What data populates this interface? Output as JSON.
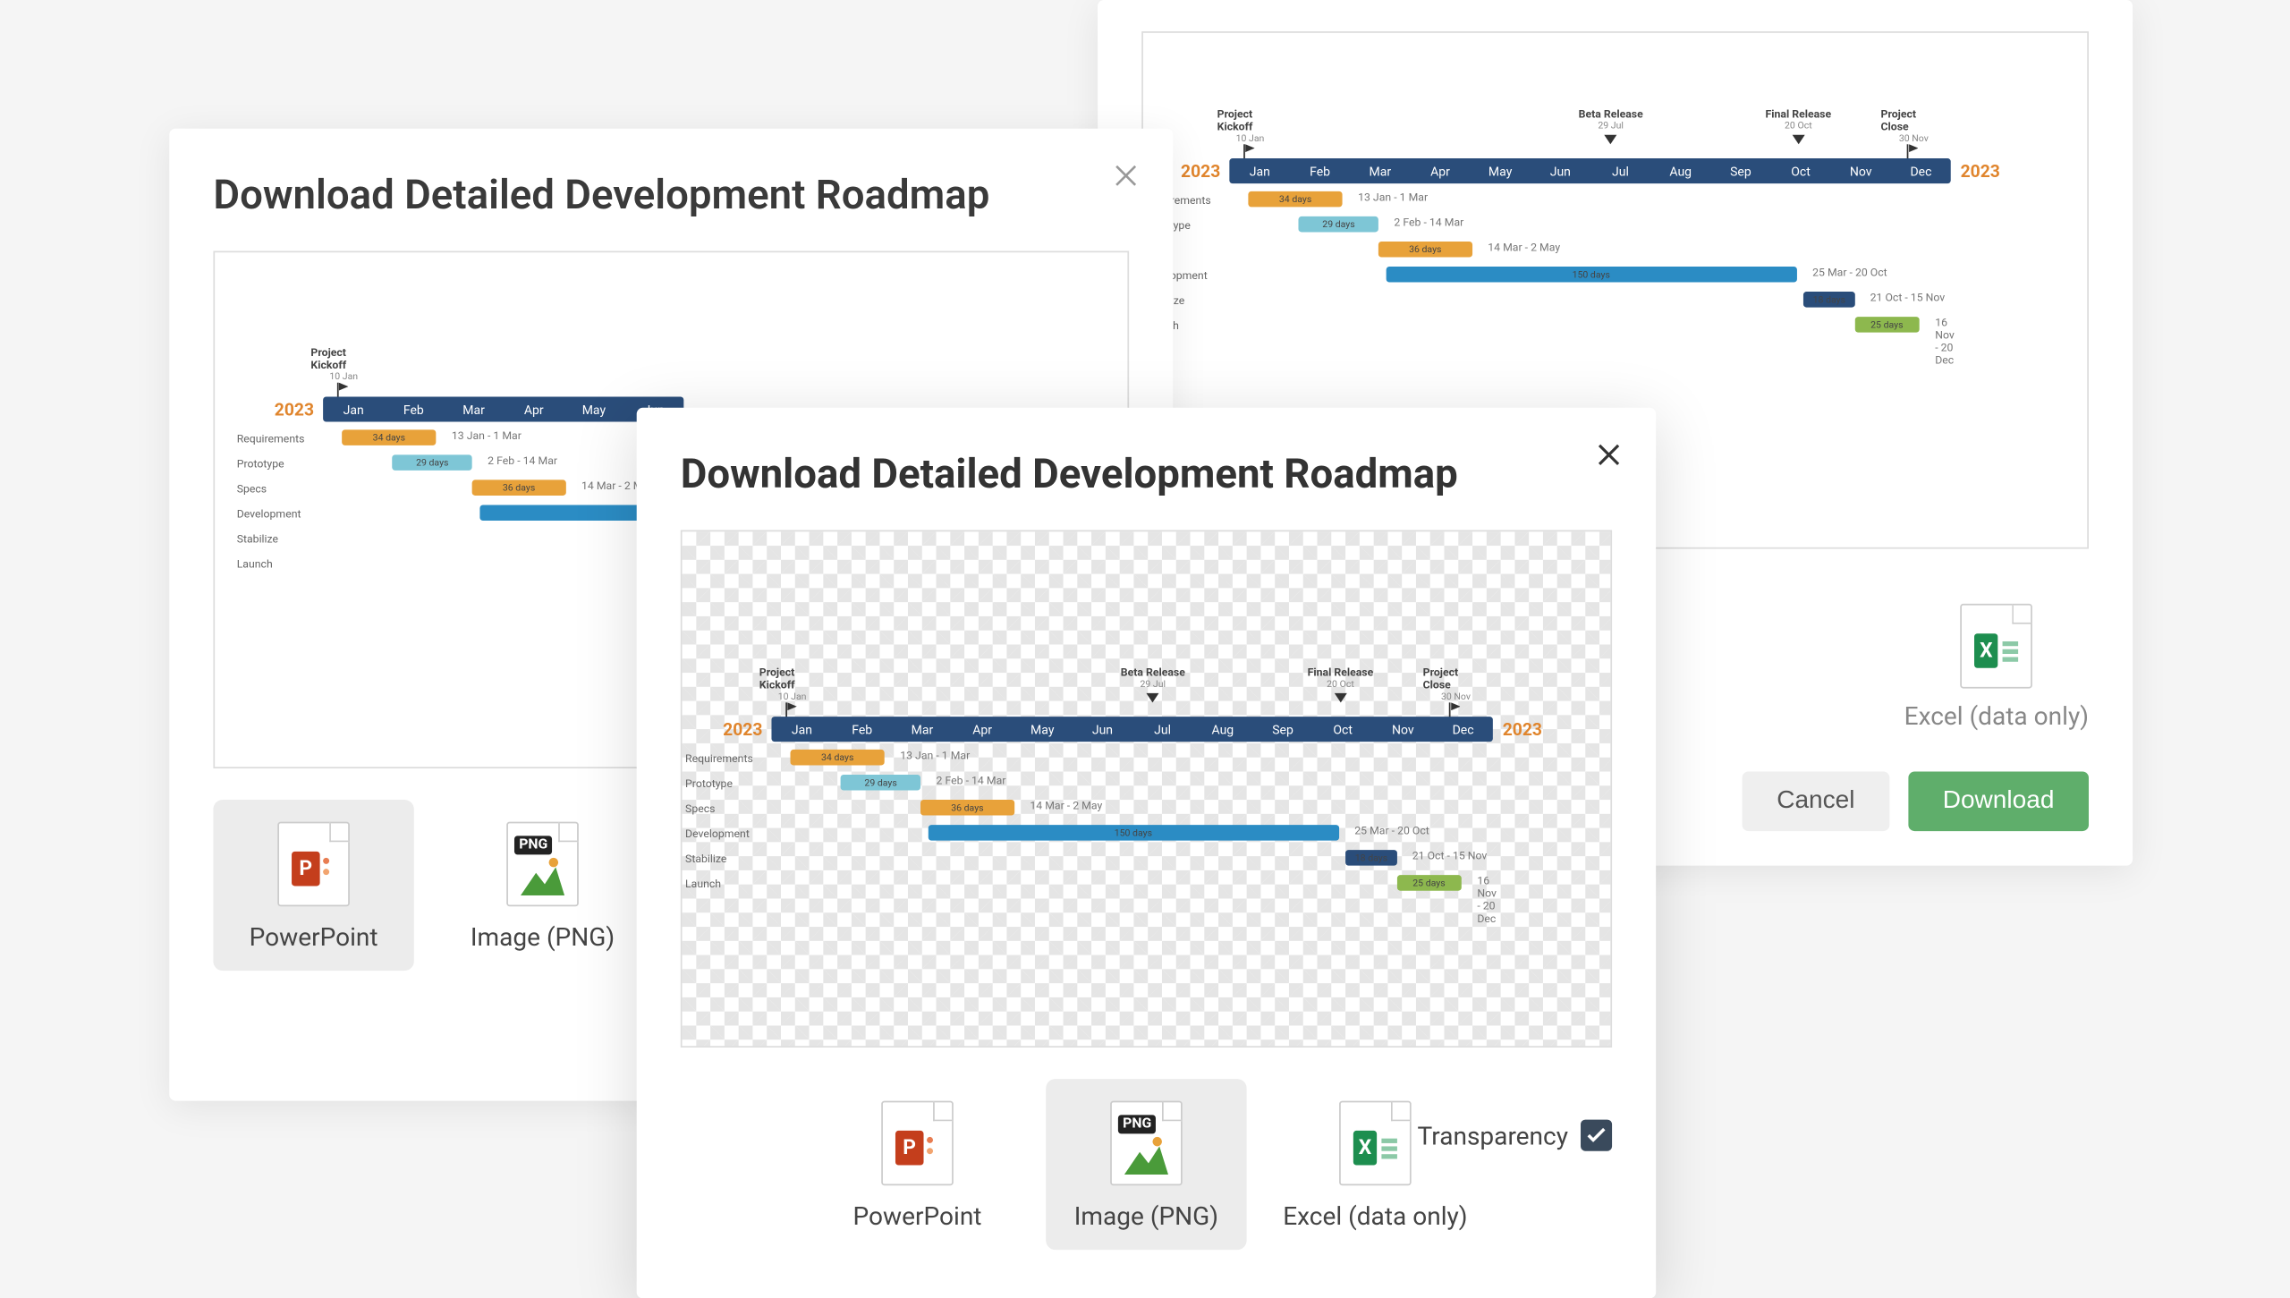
{
  "dialog_title": "Download Detailed Development Roadmap",
  "formats": {
    "powerpoint": "PowerPoint",
    "png": "Image (PNG)",
    "excel": "Excel (data only)"
  },
  "transparency_label": "Transparency",
  "buttons": {
    "cancel": "Cancel",
    "download": "Download"
  },
  "png_badge": "PNG",
  "year": "2023",
  "months": [
    "Jan",
    "Feb",
    "Mar",
    "Apr",
    "May",
    "Jun",
    "Jul",
    "Aug",
    "Sep",
    "Oct",
    "Nov",
    "Dec"
  ],
  "milestones": {
    "kickoff": {
      "label": "Project Kickoff",
      "date": "10 Jan"
    },
    "beta": {
      "label": "Beta Release",
      "date": "29 Jul"
    },
    "final": {
      "label": "Final Release",
      "date": "20 Oct"
    },
    "close": {
      "label": "Project Close",
      "date": "30 Nov"
    }
  },
  "tasks": [
    {
      "name": "Requirements",
      "duration": "34 days",
      "range": "13 Jan - 1 Mar",
      "color": "#e8a23a",
      "start": 0.02,
      "width": 0.13
    },
    {
      "name": "Prototype",
      "duration": "29 days",
      "range": "2 Feb - 14 Mar",
      "color": "#7ec6d6",
      "start": 0.09,
      "width": 0.11
    },
    {
      "name": "Specs",
      "duration": "36 days",
      "range": "14 Mar - 2 May",
      "color": "#e8a23a",
      "start": 0.2,
      "width": 0.13
    },
    {
      "name": "Development",
      "duration": "150 days",
      "range": "25 Mar - 20 Oct",
      "color": "#2b8cc4",
      "start": 0.21,
      "width": 0.57
    },
    {
      "name": "Stabilize",
      "duration": "18 days",
      "range": "21 Oct - 15 Nov",
      "color": "#2a4d7a",
      "start": 0.79,
      "width": 0.07
    },
    {
      "name": "Launch",
      "duration": "25 days",
      "range": "16 Nov - 20 Dec",
      "color": "#8db84e",
      "start": 0.86,
      "width": 0.09
    }
  ],
  "chart_data": {
    "type": "bar",
    "title": "Detailed Development Roadmap",
    "x": [
      "Jan",
      "Feb",
      "Mar",
      "Apr",
      "May",
      "Jun",
      "Jul",
      "Aug",
      "Sep",
      "Oct",
      "Nov",
      "Dec"
    ],
    "year": 2023,
    "milestones": [
      {
        "name": "Project Kickoff",
        "date": "10 Jan"
      },
      {
        "name": "Beta Release",
        "date": "29 Jul"
      },
      {
        "name": "Final Release",
        "date": "20 Oct"
      },
      {
        "name": "Project Close",
        "date": "30 Nov"
      }
    ],
    "series": [
      {
        "name": "Requirements",
        "start": "13 Jan",
        "end": "1 Mar",
        "duration_days": 34
      },
      {
        "name": "Prototype",
        "start": "2 Feb",
        "end": "14 Mar",
        "duration_days": 29
      },
      {
        "name": "Specs",
        "start": "14 Mar",
        "end": "2 May",
        "duration_days": 36
      },
      {
        "name": "Development",
        "start": "25 Mar",
        "end": "20 Oct",
        "duration_days": 150
      },
      {
        "name": "Stabilize",
        "start": "21 Oct",
        "end": "15 Nov",
        "duration_days": 18
      },
      {
        "name": "Launch",
        "start": "16 Nov",
        "end": "20 Dec",
        "duration_days": 25
      }
    ]
  }
}
